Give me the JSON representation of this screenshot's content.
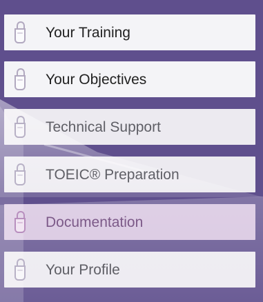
{
  "menu": {
    "items": [
      {
        "label": "Your Training",
        "icon": "padlock-icon",
        "state": "normal"
      },
      {
        "label": "Your Objectives",
        "icon": "padlock-icon",
        "state": "normal"
      },
      {
        "label": "Technical Support",
        "icon": "padlock-icon",
        "state": "dim"
      },
      {
        "label": "TOEIC® Preparation",
        "icon": "padlock-icon",
        "state": "dim"
      },
      {
        "label": "Documentation",
        "icon": "padlock-icon",
        "state": "active"
      },
      {
        "label": "Your Profile",
        "icon": "padlock-icon",
        "state": "dim"
      }
    ]
  },
  "colors": {
    "panel_background": "#5f4f8d",
    "item_background": "#f4f4f7",
    "active_background": "#d6c3df",
    "active_text": "#7c5a88"
  }
}
